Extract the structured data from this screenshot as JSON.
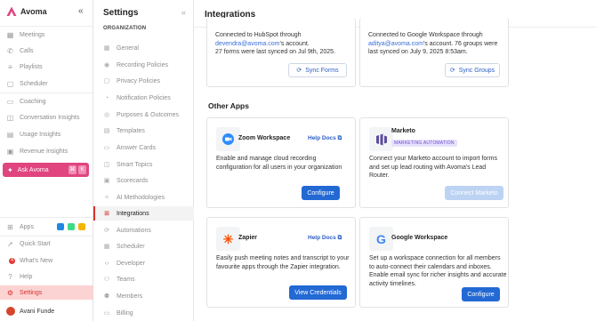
{
  "nav": {
    "brand": "Avoma",
    "items": [
      {
        "label": "Meetings",
        "icon": "calendar-icon"
      },
      {
        "label": "Calls",
        "icon": "phone-icon"
      },
      {
        "label": "Playlists",
        "icon": "playlist-icon"
      },
      {
        "label": "Scheduler",
        "icon": "scheduler-icon"
      },
      {
        "label": "Coaching",
        "icon": "coaching-icon"
      },
      {
        "label": "Conversation Insights",
        "icon": "chat-insights-icon"
      },
      {
        "label": "Usage Insights",
        "icon": "usage-insights-icon"
      },
      {
        "label": "Revenue Insights",
        "icon": "revenue-insights-icon"
      }
    ],
    "ask": {
      "label": "Ask Avoma",
      "key1": "⌘",
      "key2": "K"
    },
    "bottom": [
      {
        "label": "Apps",
        "icon": "grid-icon"
      },
      {
        "label": "Quick Start",
        "icon": "rocket-icon"
      },
      {
        "label": "What's New",
        "icon": "bell-icon"
      },
      {
        "label": "Help",
        "icon": "help-icon"
      },
      {
        "label": "Settings",
        "icon": "gear-icon"
      }
    ],
    "notification_count": "4",
    "user": "Avani Funde"
  },
  "settings": {
    "title": "Settings",
    "section": "ORGANIZATION",
    "items": [
      "General",
      "Recording Policies",
      "Privacy Policies",
      "Notification Policies",
      "Purposes & Outcomes",
      "Templates",
      "Answer Cards",
      "Smart Topics",
      "Scorecards",
      "AI Methodologies",
      "Integrations",
      "Automations",
      "Scheduler",
      "Developer",
      "Teams",
      "Members",
      "Billing"
    ],
    "active": "Integrations"
  },
  "main": {
    "title": "Integrations",
    "hubspot": {
      "line1": "Connected to HubSpot through",
      "email": "devendra@avoma.com",
      "line2_suffix": "'s account.",
      "line3": "27 forms were last synced on Jul 9th, 2025.",
      "button": "Sync Forms"
    },
    "google_top": {
      "line1": "Connected to Google Workspace through",
      "email": "aditya@avoma.com",
      "line2_suffix": "'s account. 76 groups were",
      "line3": "last synced on July 9, 2025 8:53am.",
      "button": "Sync Groups"
    },
    "other_apps_title": "Other Apps",
    "apps": {
      "zoom": {
        "name": "Zoom Workspace",
        "help": "Help Docs",
        "desc": "Enable and manage cloud recording configuration for all users in your organization",
        "button": "Configure"
      },
      "marketo": {
        "name": "Marketo",
        "tag": "MARKETING AUTOMATION",
        "desc": "Connect your Marketo account to import forms and set up lead routing with Avoma's Lead Router.",
        "button": "Connect Marketo"
      },
      "zapier": {
        "name": "Zapier",
        "help": "Help Docs",
        "desc": "Easily push meeting notes and transcript to your favourite apps through the Zapier integration.",
        "button": "View Credentials"
      },
      "gworkspace": {
        "name": "Google Workspace",
        "desc": "Set up a workspace connection for all members to auto-connect their calendars and inboxes. Enable email sync for richer insights and accurate activity timelines.",
        "button": "Configure"
      }
    }
  },
  "colors": {
    "accent": "#d8322f",
    "primary_button": "#2269d4",
    "ask_avoma": "#e0457f"
  }
}
